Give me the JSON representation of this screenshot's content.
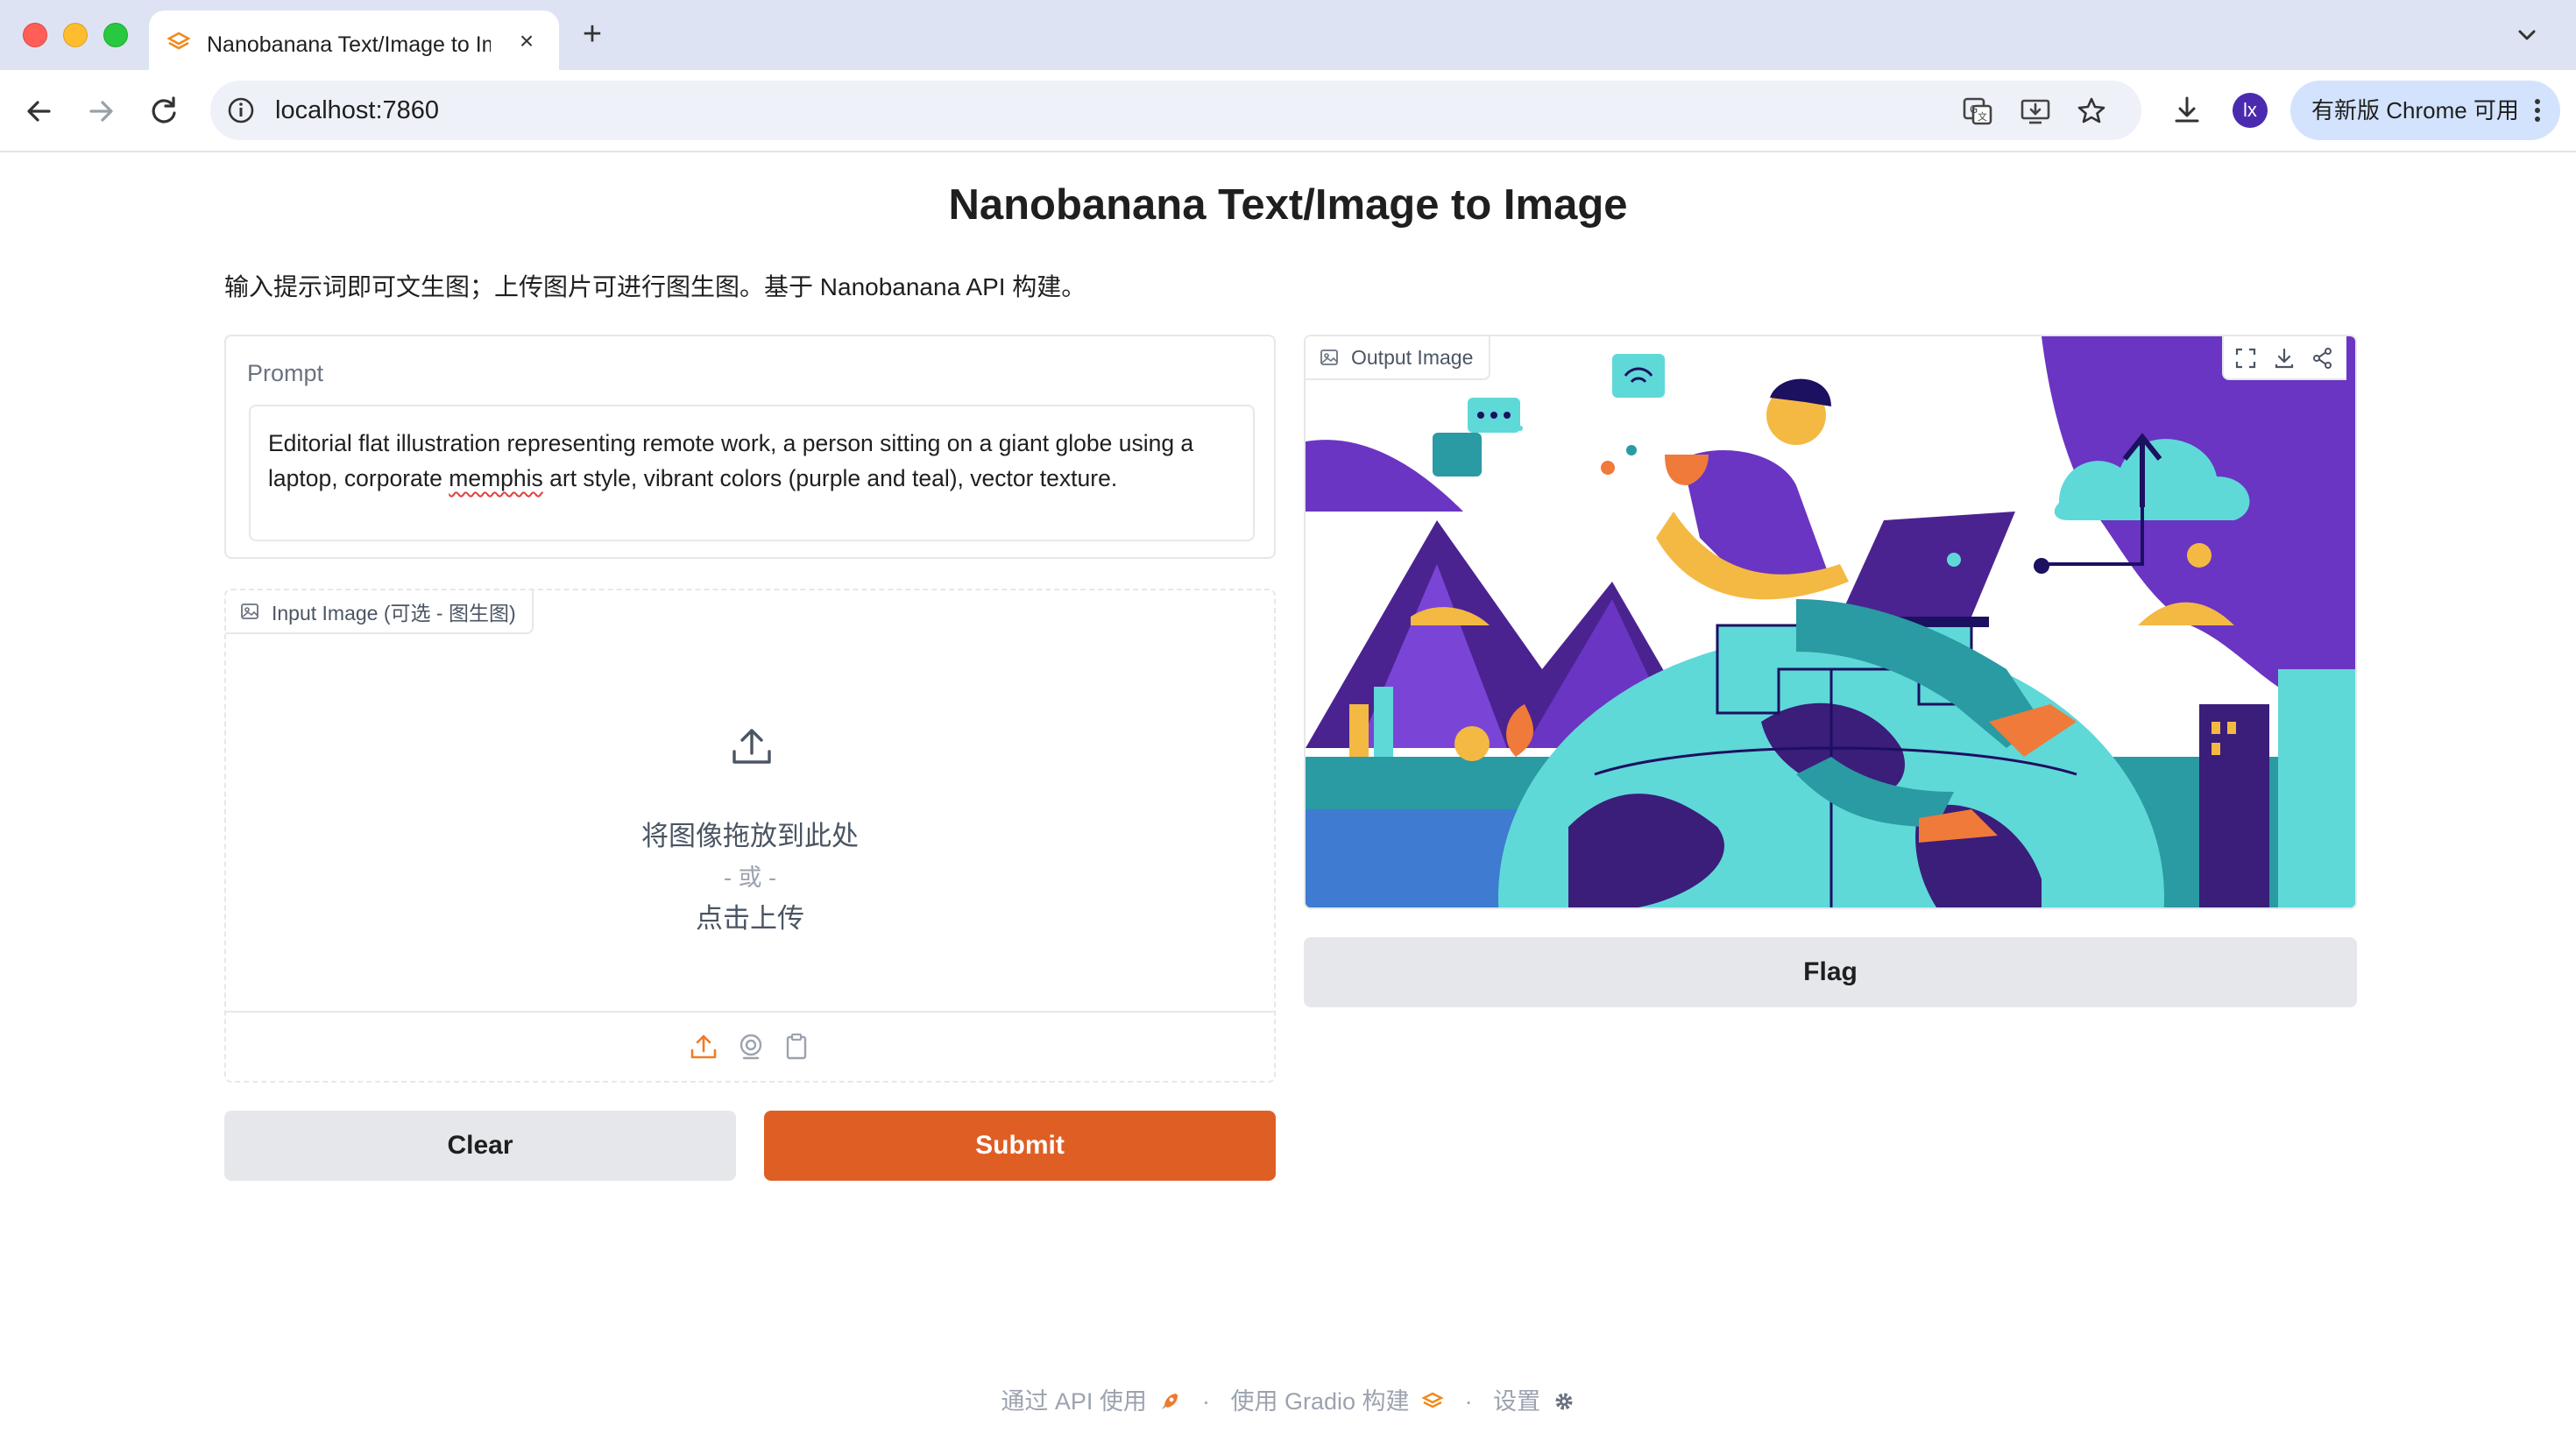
{
  "browser": {
    "tab_title": "Nanobanana Text/Image to Im",
    "url": "localhost:7860",
    "avatar_initials": "lx",
    "update_label": "有新版 Chrome 可用",
    "icons": [
      "back-icon",
      "forward-icon",
      "reload-icon",
      "info-icon",
      "translate-icon",
      "install-icon",
      "star-icon",
      "download-icon",
      "menu-icon"
    ]
  },
  "page": {
    "title": "Nanobanana Text/Image to Image",
    "description": "输入提示词即可文生图；上传图片可进行图生图。基于 Nanobanana API 构建。"
  },
  "prompt": {
    "label": "Prompt",
    "value_before": "Editorial flat illustration representing remote work, a person sitting on a giant globe using a laptop, corporate ",
    "value_misspelled": "memphis",
    "value_after": " art style, vibrant colors (purple and teal), vector texture."
  },
  "input_image": {
    "label": "Input Image (可选 - 图生图)",
    "drop_text": "将图像拖放到此处",
    "or_text": "- 或 -",
    "click_text": "点击上传"
  },
  "buttons": {
    "clear": "Clear",
    "submit": "Submit",
    "flag": "Flag"
  },
  "output_image": {
    "label": "Output Image",
    "accent_colors": {
      "purple": "#6a35c2",
      "teal": "#5fd8d8",
      "orange": "#f07a3a",
      "yellow": "#f4b942"
    }
  },
  "footer": {
    "api": "通过 API 使用",
    "gradio": "使用 Gradio 构建",
    "settings": "设置",
    "separator": "·"
  },
  "colors": {
    "accent": "#df5e24",
    "chrome_bg": "#dde3f3",
    "update_pill": "#d3e3fd"
  }
}
